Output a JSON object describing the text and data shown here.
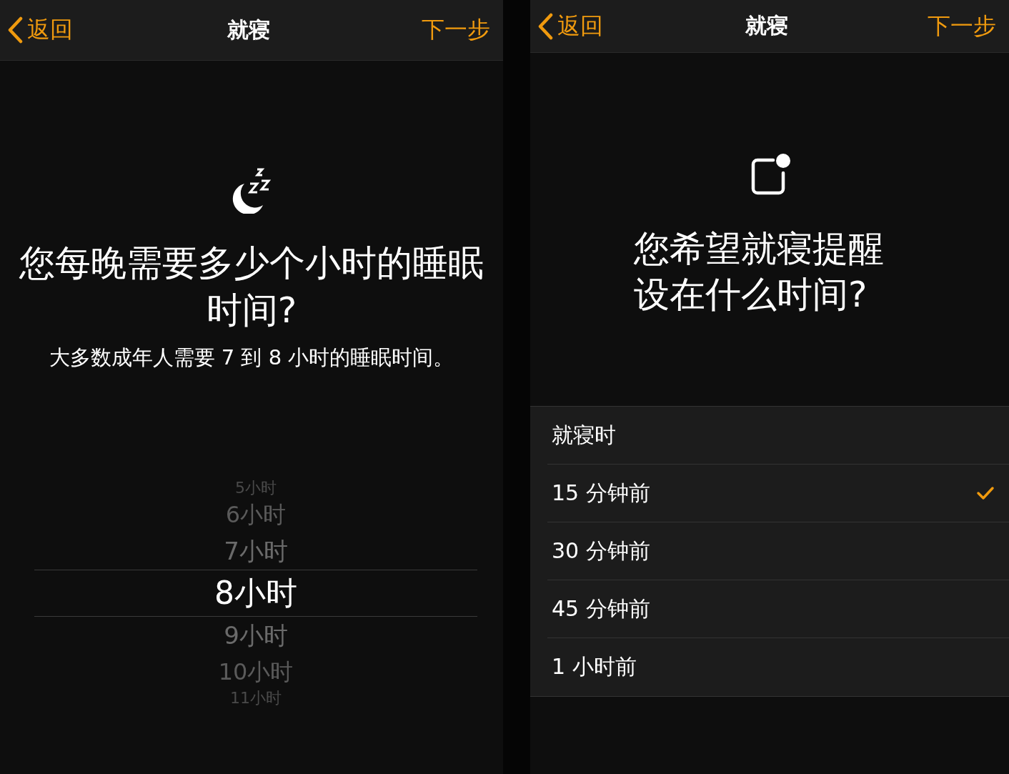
{
  "screens": [
    {
      "kind": "hours",
      "header": {
        "back": "返回",
        "title": "就寝",
        "next": "下一步"
      },
      "title": "您每晚需要多少个小时的睡眠时间?",
      "subtitle": "大多数成年人需要 7 到 8 小时的睡眠时间。",
      "picker": [
        {
          "label": "5小时",
          "selected": false
        },
        {
          "label": "6小时",
          "selected": false
        },
        {
          "label": "7小时",
          "selected": false
        },
        {
          "label": "8小时",
          "selected": true
        },
        {
          "label": "9小时",
          "selected": false
        },
        {
          "label": "10小时",
          "selected": false
        },
        {
          "label": "11小时",
          "selected": false
        }
      ]
    },
    {
      "kind": "reminder",
      "header": {
        "back": "返回",
        "title": "就寝",
        "next": "下一步"
      },
      "title": "您希望就寝提醒设在什么时间?",
      "options": [
        {
          "label": "就寝时",
          "selected": false
        },
        {
          "label": "15 分钟前",
          "selected": true
        },
        {
          "label": "30 分钟前",
          "selected": false
        },
        {
          "label": "45 分钟前",
          "selected": false
        },
        {
          "label": "1 小时前",
          "selected": false
        }
      ]
    }
  ]
}
